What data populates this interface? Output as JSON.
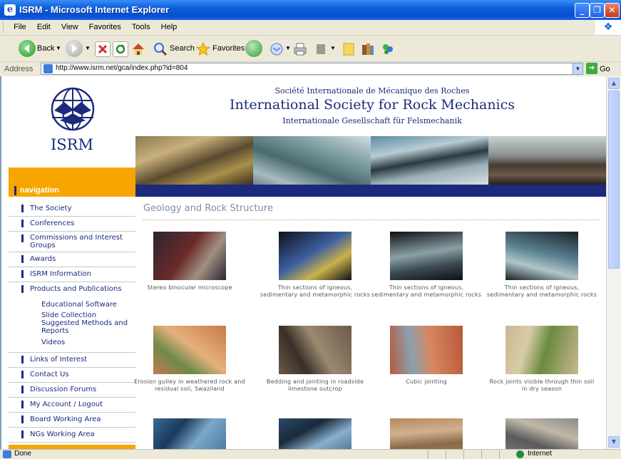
{
  "window": {
    "title": "ISRM - Microsoft Internet Explorer",
    "minimize": "_",
    "maximize": "❐",
    "close": "✕"
  },
  "menu": [
    "File",
    "Edit",
    "View",
    "Favorites",
    "Tools",
    "Help"
  ],
  "toolbar": {
    "back_label": "Back",
    "search_label": "Search",
    "favorites_label": "Favorites"
  },
  "address": {
    "label": "Address",
    "url": "http://www.isrm.net/gca/index.php?id=804",
    "go_label": "Go"
  },
  "status": {
    "text": "Done",
    "zone": "Internet"
  },
  "site": {
    "logo_text": "ISRM",
    "name_fr": "Société Internationale de Mécanique des Roches",
    "name_en": "International Society for Rock Mechanics",
    "name_de": "Internationale Gesellschaft für Felsmechanik",
    "nav_heading": "navigation"
  },
  "nav": [
    {
      "label": "The Society"
    },
    {
      "label": "Conferences"
    },
    {
      "label": "Commissions and Interest Groups"
    },
    {
      "label": "Awards"
    },
    {
      "label": "ISRM Information"
    },
    {
      "label": "Products and Publications"
    },
    {
      "label": "Links of Interest"
    },
    {
      "label": "Contact Us"
    },
    {
      "label": "Discussion Forums"
    },
    {
      "label": "My Account / Logout"
    },
    {
      "label": "Board Working Area"
    },
    {
      "label": "NGs Working Area"
    }
  ],
  "nav_sub": [
    "Educational Software",
    "Slide Collection",
    "Suggested Methods and Reports",
    "Videos"
  ],
  "page": {
    "title": "Geology and Rock Structure"
  },
  "gallery": [
    {
      "caption": "Stereo binocular microscope",
      "palette": [
        "#2a2530",
        "#6b2a2a",
        "#a09080"
      ]
    },
    {
      "caption": "Thin sections of igneous, sedimentary and metamorphic rocks",
      "palette": [
        "#101018",
        "#3c5fa0",
        "#c9b24a"
      ]
    },
    {
      "caption": "Thin sections of igneous, sedimentary and metamorphic rocks",
      "palette": [
        "#0e1012",
        "#8aa0a6",
        "#3c4a52"
      ]
    },
    {
      "caption": "Thin sections of igneous, sedimentary and metamorphic rocks",
      "palette": [
        "#1a2228",
        "#5a8090",
        "#b0c6c8"
      ]
    },
    {
      "caption": "Erosion gulley in weathered rock and residual soil, Swaziland",
      "palette": [
        "#c8794a",
        "#e6b07c",
        "#6d8b4a"
      ]
    },
    {
      "caption": "Bedding and jointing in roadside limestone outcrop",
      "palette": [
        "#6a5a48",
        "#9a8a70",
        "#3a3028"
      ]
    },
    {
      "caption": "Cubic jointing",
      "palette": [
        "#b8593a",
        "#d68860",
        "#8aa0b0"
      ]
    },
    {
      "caption": "Rock joints visible through thin soil in dry season",
      "palette": [
        "#c8b890",
        "#6b8a40",
        "#d8cca8"
      ]
    },
    {
      "caption": "",
      "palette": [
        "#3a6a9a",
        "#7aa8c8",
        "#1a3a5a"
      ]
    },
    {
      "caption": "",
      "palette": [
        "#2a4a6a",
        "#8ab0d0",
        "#1a2a3a"
      ]
    },
    {
      "caption": "",
      "palette": [
        "#b88860",
        "#8a6a48",
        "#d0b090"
      ]
    },
    {
      "caption": "",
      "palette": [
        "#8a8a8a",
        "#5a5a5a",
        "#c0b8a8"
      ]
    }
  ]
}
